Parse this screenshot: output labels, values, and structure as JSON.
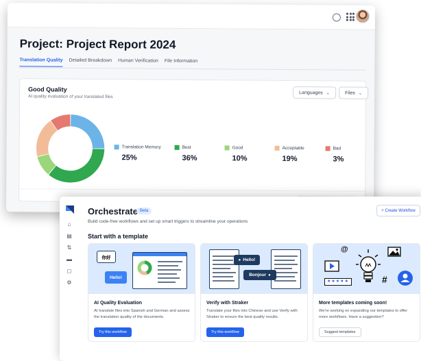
{
  "report": {
    "title": "Project: Project Report 2024",
    "tabs": [
      "Translation Quality",
      "Detailed Breakdown",
      "Human Verification",
      "File Information"
    ],
    "active_tab": 0,
    "panel": {
      "title": "Good Quality",
      "subtitle": "AI quality evaluation of your translated files",
      "languages_label": "Languages",
      "files_label": "Files"
    },
    "quality": [
      {
        "label": "Translation Memory",
        "value": "25%",
        "pct": 25,
        "color": "#6cb4e8"
      },
      {
        "label": "Best",
        "value": "36%",
        "pct": 36,
        "color": "#2fa84f"
      },
      {
        "label": "Good",
        "value": "10%",
        "pct": 10,
        "color": "#9bd67a"
      },
      {
        "label": "Acceptable",
        "value": "19%",
        "pct": 19,
        "color": "#f2bc99"
      },
      {
        "label": "Bad",
        "value": "3%",
        "pct": 10,
        "color": "#e5796f"
      }
    ]
  },
  "orchestrate": {
    "title": "Orchestrate",
    "badge": "Beta",
    "subtitle": "Build code-free workflows and set up smart triggers to streamline your operations",
    "create_label": "+ Create Workflow",
    "section_title": "Start with a template",
    "templates": [
      {
        "title": "AI Quality Evaluation",
        "desc": "AI translate files into Spanish and German and assess the translation quality of the documents.",
        "button": "Try this workflow",
        "art_text1": "你好",
        "art_text2": "Hello!"
      },
      {
        "title": "Verify with Straker",
        "desc": "Translate your files into Chinese and use Verify with Straker to ensure the best quality results.",
        "button": "Try this workflow",
        "art_text1": "Hello!",
        "art_text2": "Bonjour"
      },
      {
        "title": "More templates coming soon!",
        "desc": "We're working on expanding our templates to offer more workflows. Have a suggestion?",
        "button": "Suggest templates",
        "art_text1": "@",
        "art_text2": "#"
      }
    ]
  }
}
